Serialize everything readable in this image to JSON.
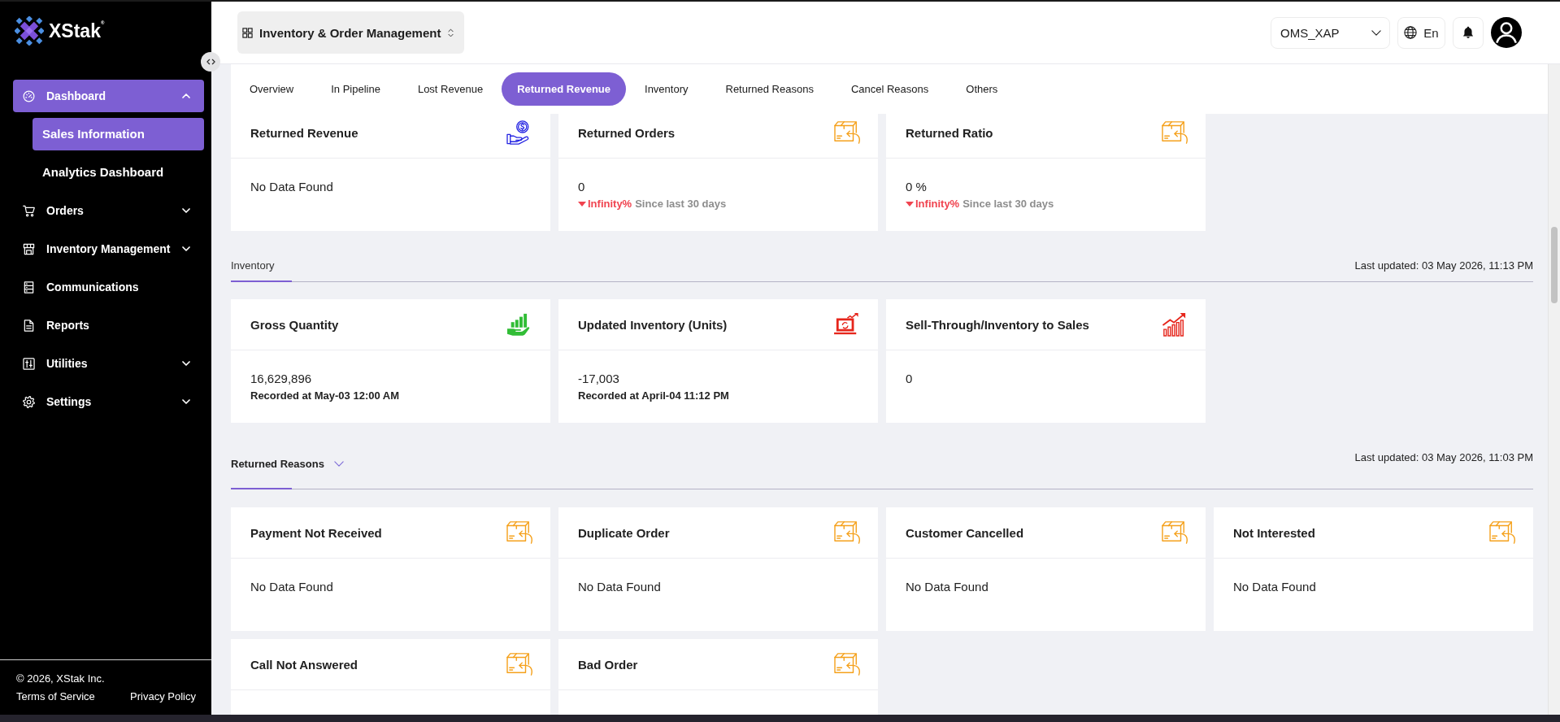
{
  "sidebar": {
    "logo": "XStak$^{®}$",
    "items": [
      {
        "label": "Dashboard",
        "kind": "dashboard",
        "selected": true,
        "expanded": true,
        "children": [
          {
            "label": "Sales Information",
            "selected": true
          },
          {
            "label": "Analytics Dashboard",
            "selected": false
          }
        ]
      },
      {
        "label": "Orders",
        "kind": "orders",
        "selected": false,
        "expanded": false
      },
      {
        "label": "Inventory Management",
        "kind": "inventory",
        "selected": false,
        "expanded": false
      },
      {
        "label": "Communications",
        "kind": "communications",
        "selected": false
      },
      {
        "label": "Reports",
        "kind": "reports",
        "selected": false
      },
      {
        "label": "Utilities",
        "kind": "utilities",
        "selected": false,
        "expanded": false
      },
      {
        "label": "Settings",
        "kind": "settings",
        "selected": false,
        "expanded": false
      }
    ],
    "footer": {
      "copyright": "© 2026, XStak Inc.",
      "links": [
        "Terms of Service",
        "Privacy Policy"
      ]
    }
  },
  "header": {
    "app_switcher": "Inventory & Order Management",
    "store_select": "OMS_XAP",
    "language": "En"
  },
  "tabs": [
    {
      "label": "Overview",
      "selected": false
    },
    {
      "label": "In Pipeline",
      "selected": false
    },
    {
      "label": "Lost Revenue",
      "selected": false
    },
    {
      "label": "Returned Revenue",
      "selected": true
    },
    {
      "label": "Inventory",
      "selected": false
    },
    {
      "label": "Returned Reasons",
      "selected": false
    },
    {
      "label": "Cancel Reasons",
      "selected": false
    },
    {
      "label": "Others",
      "selected": false
    }
  ],
  "sections": [
    {
      "cards": [
        {
          "title": "Returned Revenue",
          "kind": "revenue",
          "message": "No Data Found"
        },
        {
          "title": "Returned Orders",
          "kind": "returns",
          "value": "0",
          "change": {
            "decrease": true,
            "value": "Infinity%",
            "note": "Since last 30 days"
          }
        },
        {
          "title": "Returned Ratio",
          "kind": "returns",
          "value": "0 %",
          "change": {
            "decrease": true,
            "value": "Infinity%",
            "note": "Since last 30 days"
          }
        }
      ]
    },
    {
      "title": "Inventory",
      "collapsible": false,
      "last_updated": "Last updated: 03 May 2026, 11:13 PM",
      "cards": [
        {
          "title": "Gross Quantity",
          "kind": "stock",
          "value": "16,629,896",
          "recorded": "Recorded at May-03 12:00 AM"
        },
        {
          "title": "Updated Inventory (Units)",
          "kind": "units",
          "value": "-17,003",
          "recorded": "Recorded at April-04 11:12 PM"
        },
        {
          "title": "Sell-Through/Inventory to Sales",
          "kind": "sales",
          "value": "0"
        }
      ]
    },
    {
      "title": "Returned Reasons",
      "collapsible": true,
      "last_updated": "Last updated: 03 May 2026, 11:03 PM",
      "cards": [
        {
          "title": "Payment Not Received",
          "kind": "returns",
          "message": "No Data Found"
        },
        {
          "title": "Duplicate Order",
          "kind": "returns",
          "message": "No Data Found"
        },
        {
          "title": "Customer Cancelled",
          "kind": "returns",
          "message": "No Data Found"
        },
        {
          "title": "Not Interested",
          "kind": "returns",
          "message": "No Data Found"
        },
        {
          "title": "Call Not Answered",
          "kind": "returns"
        },
        {
          "title": "Bad Order",
          "kind": "returns"
        }
      ]
    }
  ]
}
